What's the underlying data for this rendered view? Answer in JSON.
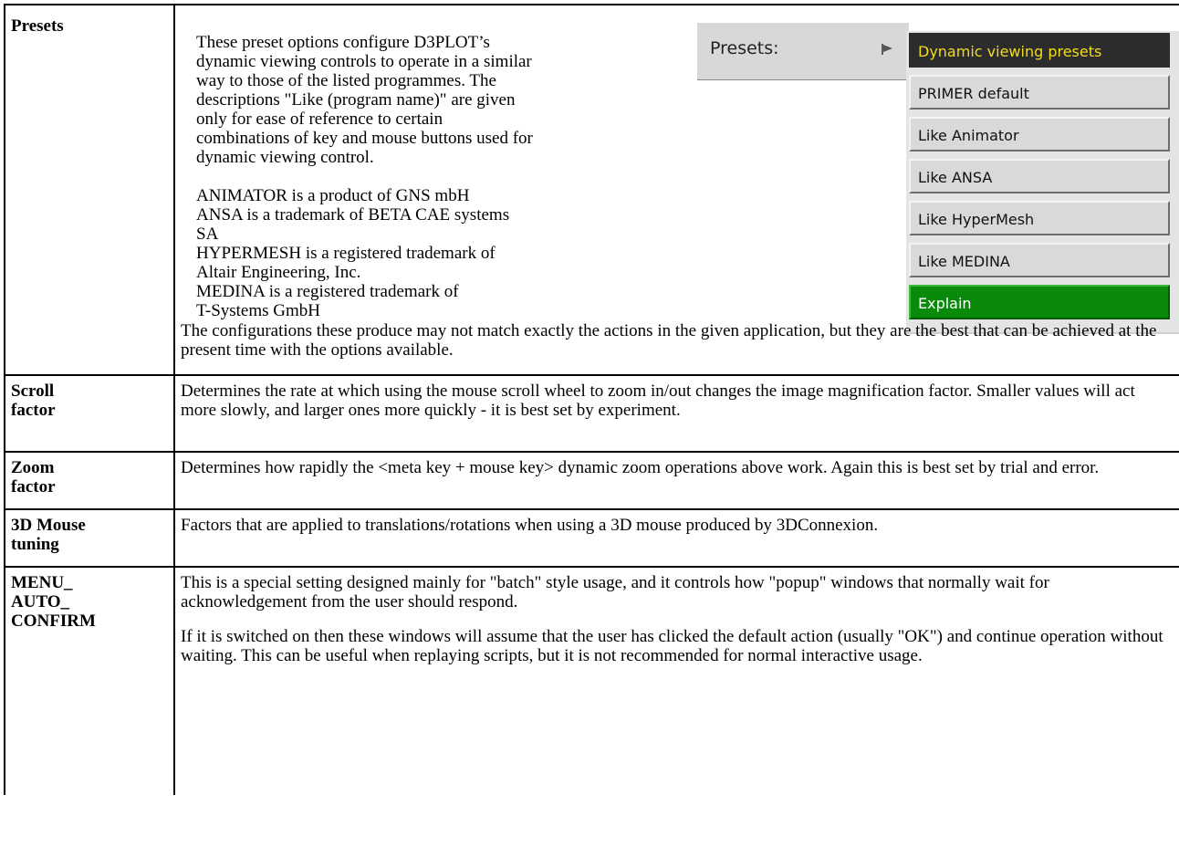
{
  "rows": {
    "presets": {
      "term": "Presets",
      "intro": [
        "These preset options configure D3PLOT’s",
        "dynamic viewing controls to operate in a similar",
        "way to those of the listed programmes. The",
        "descriptions \"Like (program name)\" are given",
        "only for ease of reference to certain",
        "combinations of key and mouse buttons used for",
        "dynamic viewing control."
      ],
      "trademarks": [
        "ANIMATOR is a product of GNS mbH",
        "ANSA is a trademark of BETA CAE systems",
        "SA",
        "HYPERMESH is a registered trademark of",
        "Altair Engineering, Inc.",
        "MEDINA is a registered trademark of",
        "T-Systems GmbH"
      ],
      "note": "The configurations these produce may not match exactly the actions in the given application, but they are the best that can be achieved at the present time with the options available.",
      "ui": {
        "bar_label": "Presets:",
        "menu_items": [
          "Dynamic viewing presets",
          "PRIMER default",
          "Like Animator",
          "Like ANSA",
          "Like HyperMesh",
          "Like MEDINA",
          "Explain"
        ],
        "colors": {
          "header_bg": "#2c2c2c",
          "header_text": "#f2dc1c",
          "explain_bg": "#0a8a0a",
          "item_bg": "#d9d9d9"
        }
      }
    },
    "scroll": {
      "term_1": "Scroll",
      "term_2": "factor",
      "text": "Determines the rate at which using the mouse scroll wheel to zoom in/out changes the image magnification factor. Smaller values will act more slowly, and larger ones more quickly - it is best set by experiment."
    },
    "zoom": {
      "term_1": "Zoom",
      "term_2": "factor",
      "text": "Determines how rapidly the <meta key + mouse key> dynamic zoom operations above work. Again this is best set by trial and error."
    },
    "mouse3d": {
      "term_1": "3D Mouse",
      "term_2": "tuning",
      "text": "Factors that are applied to translations/rotations when using a 3D mouse produced by 3DConnexion."
    },
    "menu_auto_confirm": {
      "term_1": "MENU_",
      "term_2": "AUTO_",
      "term_3": "CONFIRM",
      "para_1": "This is a special setting designed mainly for \"batch\" style usage, and it controls how \"popup\" windows that normally wait for acknowledgement from the user should respond.",
      "para_2": "If it is switched on then these windows will assume that the user has clicked the default action (usually \"OK\") and continue operation without waiting. This can be useful when replaying scripts, but it is not recommended for normal interactive usage."
    }
  }
}
